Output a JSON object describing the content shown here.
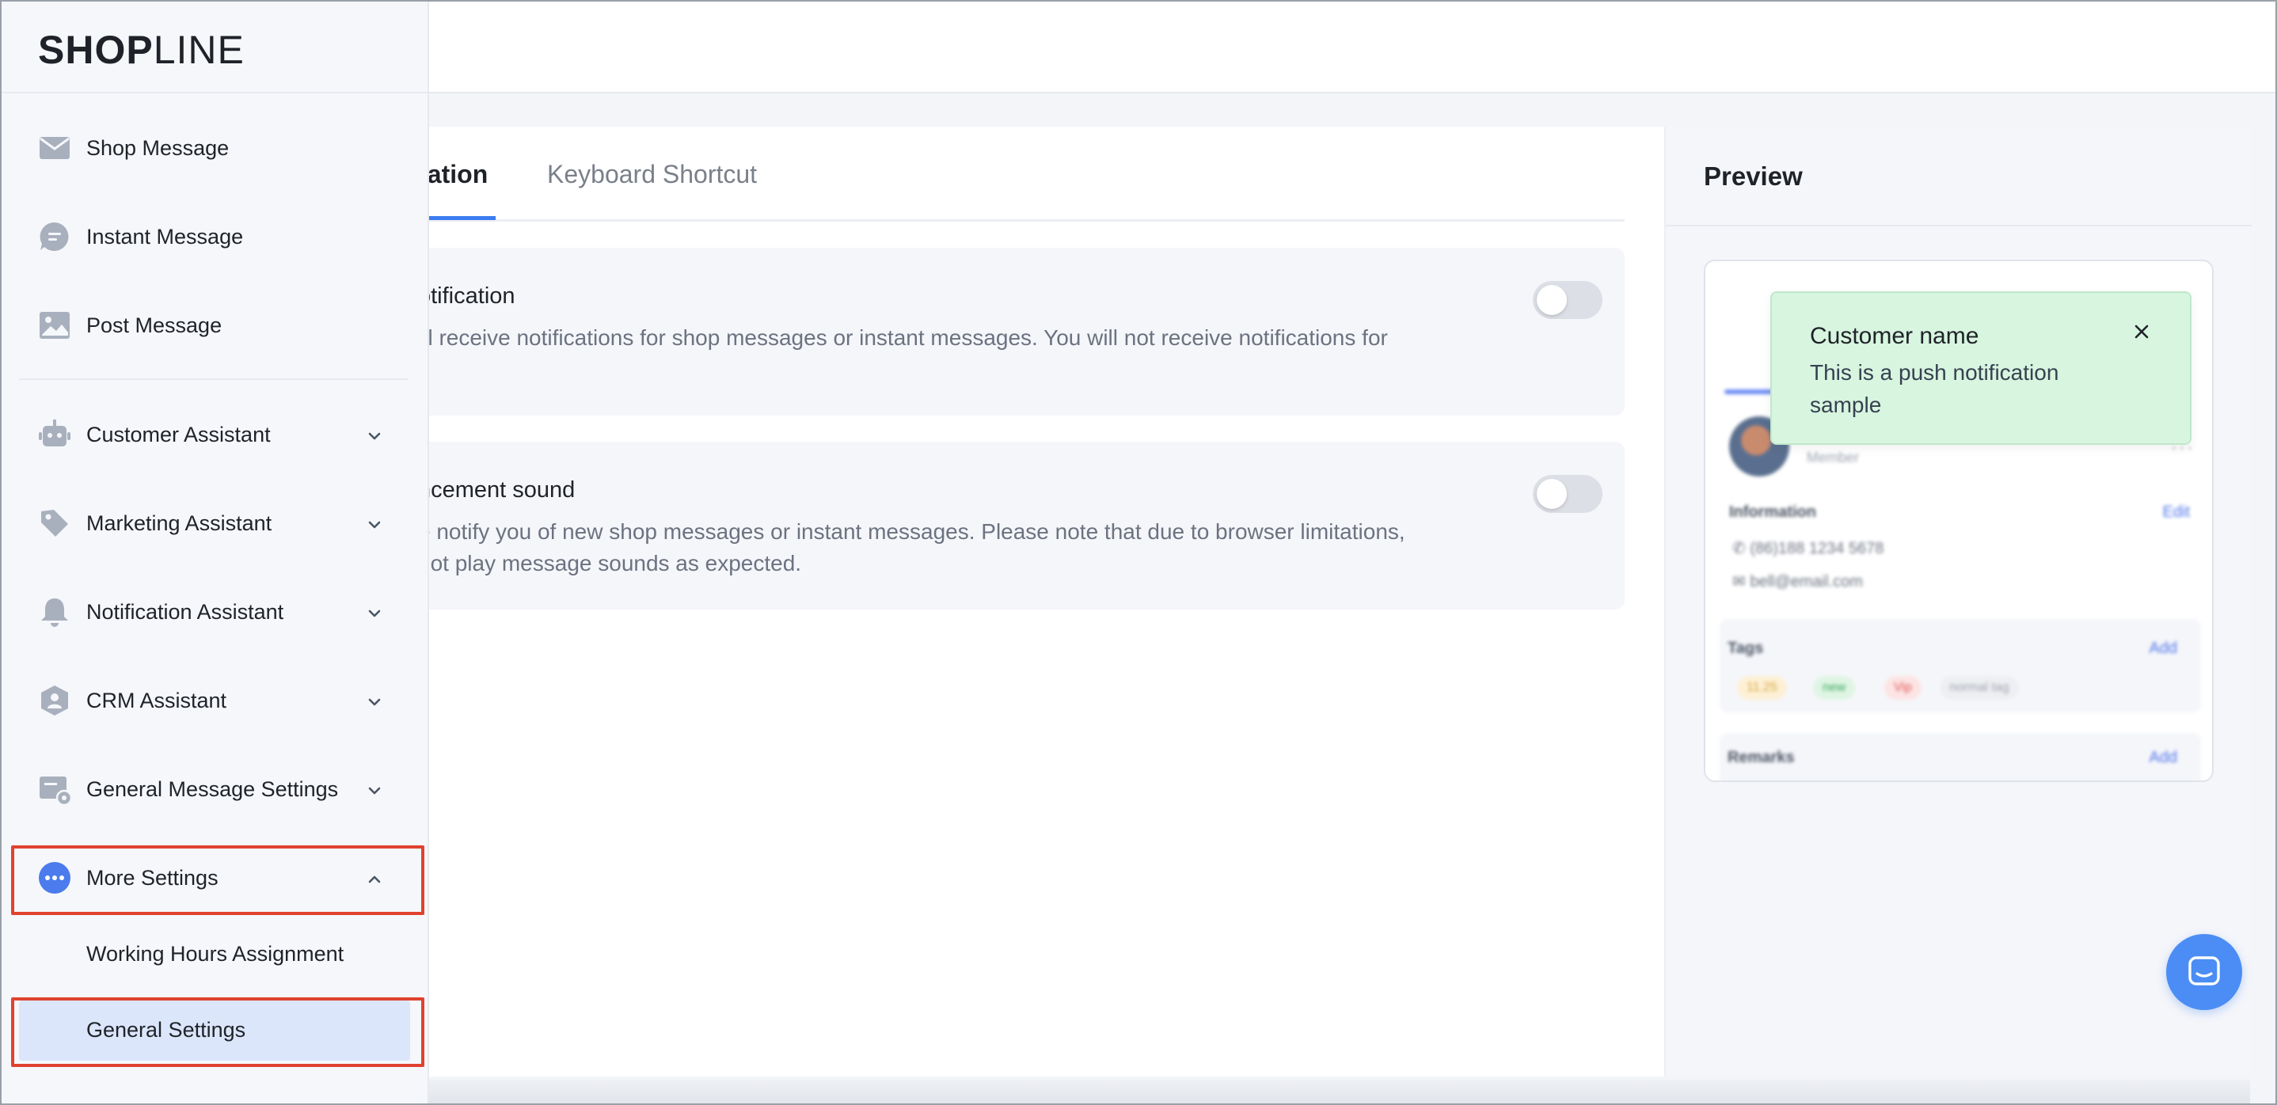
{
  "brand": {
    "logo_bold": "SHOP",
    "logo_light": "LINE"
  },
  "sidebar": {
    "items": [
      {
        "label": "Shop Message",
        "icon": "envelope-icon"
      },
      {
        "label": "Instant Message",
        "icon": "chat-bubble-icon"
      },
      {
        "label": "Post Message",
        "icon": "image-icon"
      },
      {
        "label": "Customer Assistant",
        "icon": "robot-icon"
      },
      {
        "label": "Marketing Assistant",
        "icon": "tag-icon"
      },
      {
        "label": "Notification Assistant",
        "icon": "bell-icon"
      },
      {
        "label": "CRM Assistant",
        "icon": "user-shield-icon"
      },
      {
        "label": "General Message Settings",
        "icon": "message-settings-icon"
      },
      {
        "label": "More Settings",
        "icon": "more-dots-icon"
      }
    ],
    "sub_items": [
      {
        "label": "Working Hours Assignment"
      },
      {
        "label": "General Settings"
      }
    ],
    "accent_color": "#4b7bec",
    "highlight_color": "#e0422f"
  },
  "tabs": {
    "active": "cation",
    "inactive": "Keyboard Shortcut"
  },
  "settings": {
    "notification": {
      "title": "otification",
      "desc": "ill receive notifications for shop messages or instant messages. You will not receive notifications for",
      "enabled": false
    },
    "sound": {
      "title": "ncement sound",
      "desc_line1": "e notify you of new shop messages or instant messages. Please note that due to browser limitations,",
      "desc_line2": "not play message sounds as expected.",
      "enabled": false
    }
  },
  "preview": {
    "title": "Preview",
    "card": {
      "member": "Member",
      "info_label": "Information",
      "edit": "Edit",
      "phone": "(86)188 1234 5678",
      "email": "bell@email.com",
      "tags_label": "Tags",
      "add": "Add",
      "tags": [
        "11.25",
        "new",
        "Vip",
        "normal tag"
      ],
      "remarks_label": "Remarks"
    },
    "toast": {
      "title": "Customer name",
      "body": "This is a push notification sample"
    }
  }
}
